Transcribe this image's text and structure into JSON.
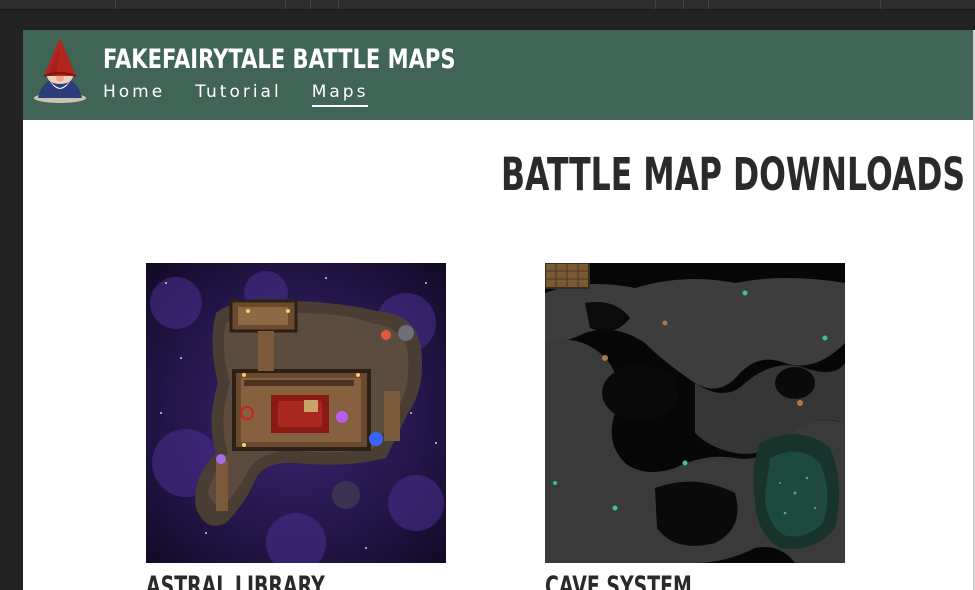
{
  "site": {
    "title": "FAKEFAIRYTALE BATTLE MAPS",
    "logo_icon": "gnome-logo-icon"
  },
  "nav": {
    "items": [
      {
        "label": "Home",
        "active": false
      },
      {
        "label": "Tutorial",
        "active": false
      },
      {
        "label": "Maps",
        "active": true
      }
    ]
  },
  "main": {
    "heading": "BATTLE MAP DOWNLOADS",
    "maps": [
      {
        "name": "ASTRAL LIBRARY"
      },
      {
        "name": "CAVE SYSTEM"
      }
    ]
  },
  "colors": {
    "header_bg": "#406455",
    "heading_text": "#2a2a2a",
    "app_chrome": "#232323"
  }
}
